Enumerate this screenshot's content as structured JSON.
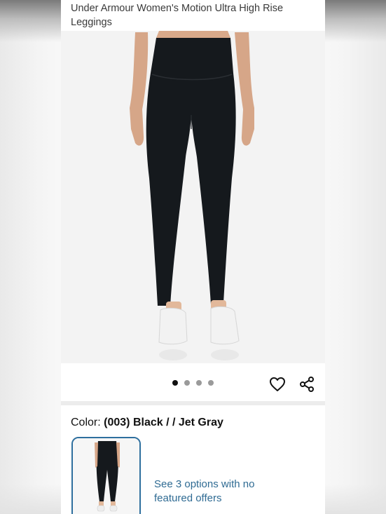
{
  "product": {
    "title": "Under Armour Women's Motion Ultra High Rise Leggings",
    "image_alt": "Black high rise leggings on model",
    "gallery": {
      "count": 4,
      "active_index": 0
    }
  },
  "actions": {
    "wishlist_icon": "heart-outline-icon",
    "share_icon": "share-icon"
  },
  "color": {
    "label": "Color:",
    "value": "(003) Black / / Jet Gray"
  },
  "offers": {
    "text": "See 3 options with no featured offers"
  },
  "colors": {
    "link": "#2f6b93",
    "swatch_border": "#2e6f9e",
    "legging": "#15191d"
  }
}
